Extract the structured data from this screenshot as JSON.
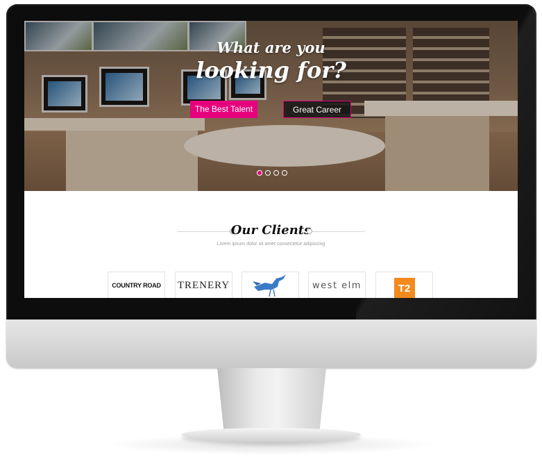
{
  "hero": {
    "title_line1": "What are you",
    "title_line2": "looking for?",
    "buttons": [
      {
        "label": "The Best Talent",
        "color": "#e6007e"
      },
      {
        "label": "Great Career",
        "color": "#1a1a1a"
      }
    ],
    "slider_dots": 4,
    "active_dot": 1
  },
  "clients": {
    "title": "Our Clients",
    "subtitle": "Lorem ipsum dolor sit amet consectetur adipiscing",
    "logos": [
      {
        "text": "COUNTRY ROAD"
      },
      {
        "text": "TRENERY"
      },
      {
        "icon": "stork-bird-icon"
      },
      {
        "text": "west elm"
      },
      {
        "text": "T2",
        "color": "#f28a1e"
      }
    ]
  },
  "accent_color": "#e6007e"
}
